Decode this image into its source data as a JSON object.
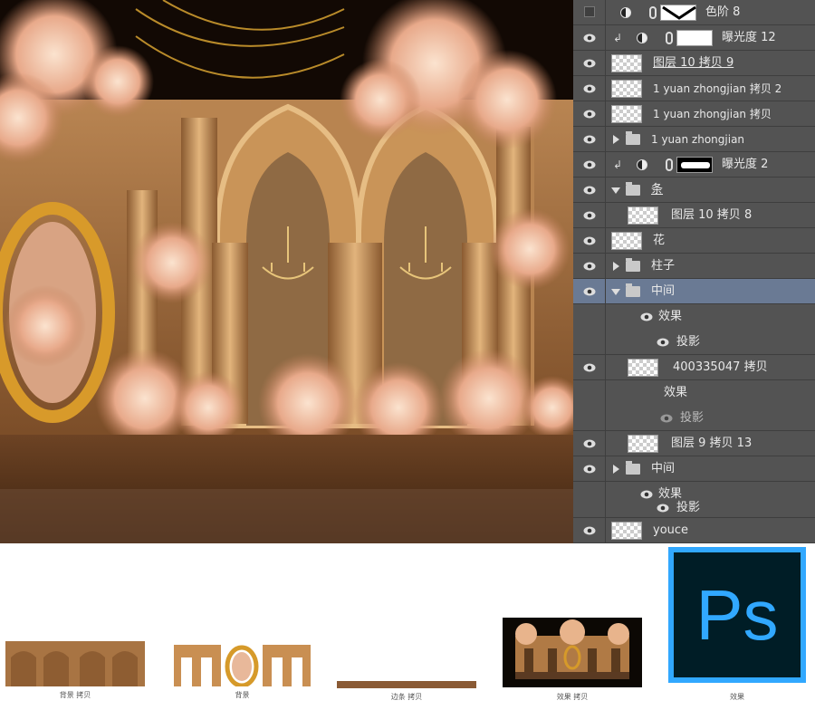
{
  "layers": [
    {
      "name": "色阶 8",
      "visible": false,
      "kind": "adjustment",
      "mask": "levels"
    },
    {
      "name": "曝光度 12",
      "visible": true,
      "kind": "adjustment",
      "clipped": true,
      "mask": "white"
    },
    {
      "name": "图层 10 拷贝 9",
      "visible": true,
      "kind": "pixel"
    },
    {
      "name": "1 yuan zhongjian 拷贝 2",
      "visible": true,
      "kind": "pixel"
    },
    {
      "name": "1 yuan zhongjian  拷贝",
      "visible": true,
      "kind": "pixel"
    },
    {
      "name": "1 yuan zhongjian",
      "visible": true,
      "kind": "group",
      "expanded": false
    },
    {
      "name": "曝光度 2",
      "visible": true,
      "kind": "adjustment",
      "clipped": true,
      "mask": "black-white"
    },
    {
      "name": "条",
      "visible": true,
      "kind": "group",
      "expanded": true
    },
    {
      "name": "图层 10 拷贝 8",
      "visible": true,
      "kind": "pixel"
    },
    {
      "name": "花",
      "visible": true,
      "kind": "pixel"
    },
    {
      "name": "柱子",
      "visible": true,
      "kind": "group",
      "expanded": false
    },
    {
      "name": "中间",
      "visible": true,
      "kind": "group",
      "expanded": true,
      "selected": true
    },
    {
      "name": "效果",
      "visible": true,
      "kind": "effect"
    },
    {
      "name": "投影",
      "visible": true,
      "kind": "effect-item"
    },
    {
      "name": "400335047 拷贝",
      "visible": true,
      "kind": "pixel"
    },
    {
      "name": "效果",
      "visible": false,
      "kind": "effect"
    },
    {
      "name": "投影",
      "visible": true,
      "kind": "effect-item-dim"
    },
    {
      "name": "图层 9 拷贝 13",
      "visible": true,
      "kind": "pixel"
    },
    {
      "name": "中间",
      "visible": true,
      "kind": "group",
      "expanded": false
    },
    {
      "name": "效果",
      "visible": true,
      "kind": "effect"
    },
    {
      "name": "投影",
      "visible": true,
      "kind": "effect-item"
    },
    {
      "name": "youce",
      "visible": true,
      "kind": "pixel"
    }
  ],
  "files": [
    {
      "caption": "背景 拷贝",
      "icon": "arches-wall-thumbnail"
    },
    {
      "caption": "背景",
      "icon": "arches-frame-thumbnail"
    },
    {
      "caption": "边条 拷贝",
      "icon": "border-strip-thumbnail"
    },
    {
      "caption": "效果 拷贝",
      "icon": "stage-preview-thumbnail"
    },
    {
      "caption": "效果",
      "icon": "photoshop-file-icon",
      "ps_label": "Ps"
    }
  ],
  "colors": {
    "panel": "#535353",
    "selected": "#6a7a94",
    "ps_bg": "#001d26",
    "ps_fg": "#31a8ff"
  }
}
